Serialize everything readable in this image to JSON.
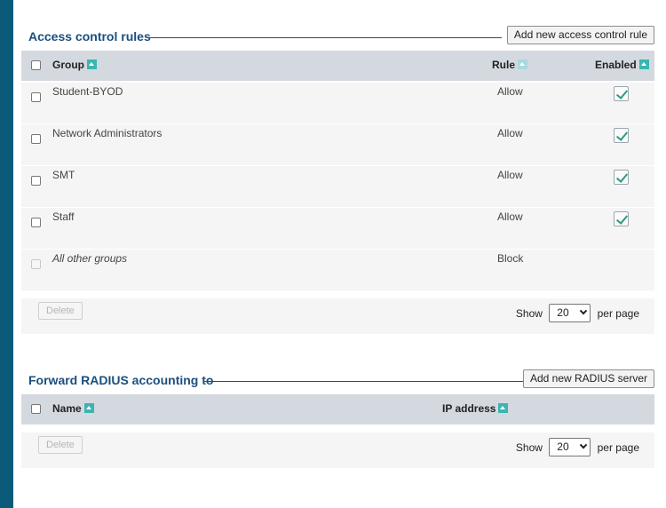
{
  "access_section": {
    "title": "Access control rules",
    "add_button": "Add new access control rule",
    "columns": {
      "group": "Group",
      "rule": "Rule",
      "enabled": "Enabled"
    },
    "rows": [
      {
        "group": "Student-BYOD",
        "rule": "Allow",
        "enabled": true
      },
      {
        "group": "Network Administrators",
        "rule": "Allow",
        "enabled": true
      },
      {
        "group": "SMT",
        "rule": "Allow",
        "enabled": true
      },
      {
        "group": "Staff",
        "rule": "Allow",
        "enabled": true
      },
      {
        "group": "All other groups",
        "rule": "Block",
        "enabled": false
      }
    ],
    "delete_button": "Delete",
    "pager": {
      "show": "Show",
      "per_page_value": "20",
      "per_page": "per page"
    }
  },
  "radius_section": {
    "title": "Forward RADIUS accounting to",
    "add_button": "Add new RADIUS server",
    "columns": {
      "name": "Name",
      "ip": "IP address"
    },
    "delete_button": "Delete",
    "pager": {
      "show": "Show",
      "per_page_value": "20",
      "per_page": "per page"
    }
  },
  "colors": {
    "sidebar": "#0b5a7a",
    "title": "#1a4f7f",
    "header_bg": "#d4d9e0",
    "sort_icon": "#3ab5b0",
    "check": "#2f9a7e"
  }
}
